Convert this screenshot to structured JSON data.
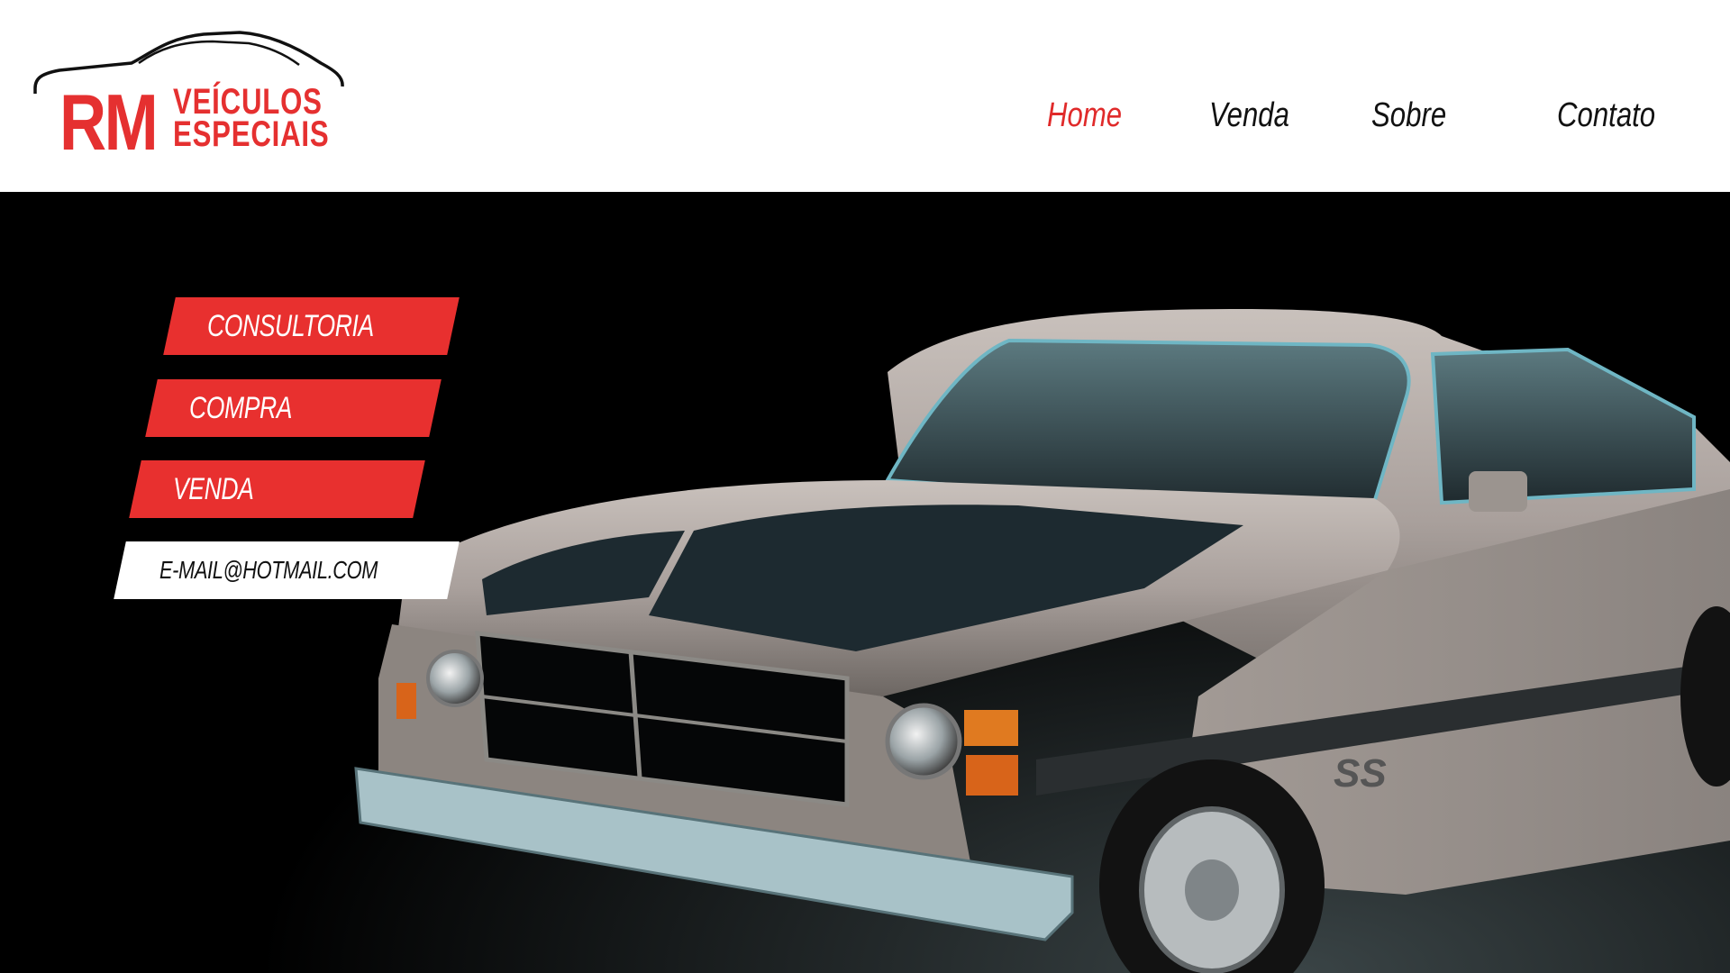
{
  "brand": {
    "mark": "RM",
    "line1": "VEÍCULOS",
    "line2": "ESPECIAIS",
    "color": "#e53030"
  },
  "nav": {
    "items": [
      {
        "label": "Home",
        "active": true
      },
      {
        "label": "Venda",
        "active": false
      },
      {
        "label": "Sobre",
        "active": false
      },
      {
        "label": "Contato",
        "active": false
      }
    ],
    "active_color": "#e02a2a"
  },
  "hero": {
    "buttons": {
      "consultoria": "CONSULTORIA",
      "compra": "COMPRA",
      "venda": "VENDA"
    },
    "email": "E-MAIL@HOTMAIL.COM",
    "car_badge": "SS",
    "accent_color": "#e8302f"
  }
}
